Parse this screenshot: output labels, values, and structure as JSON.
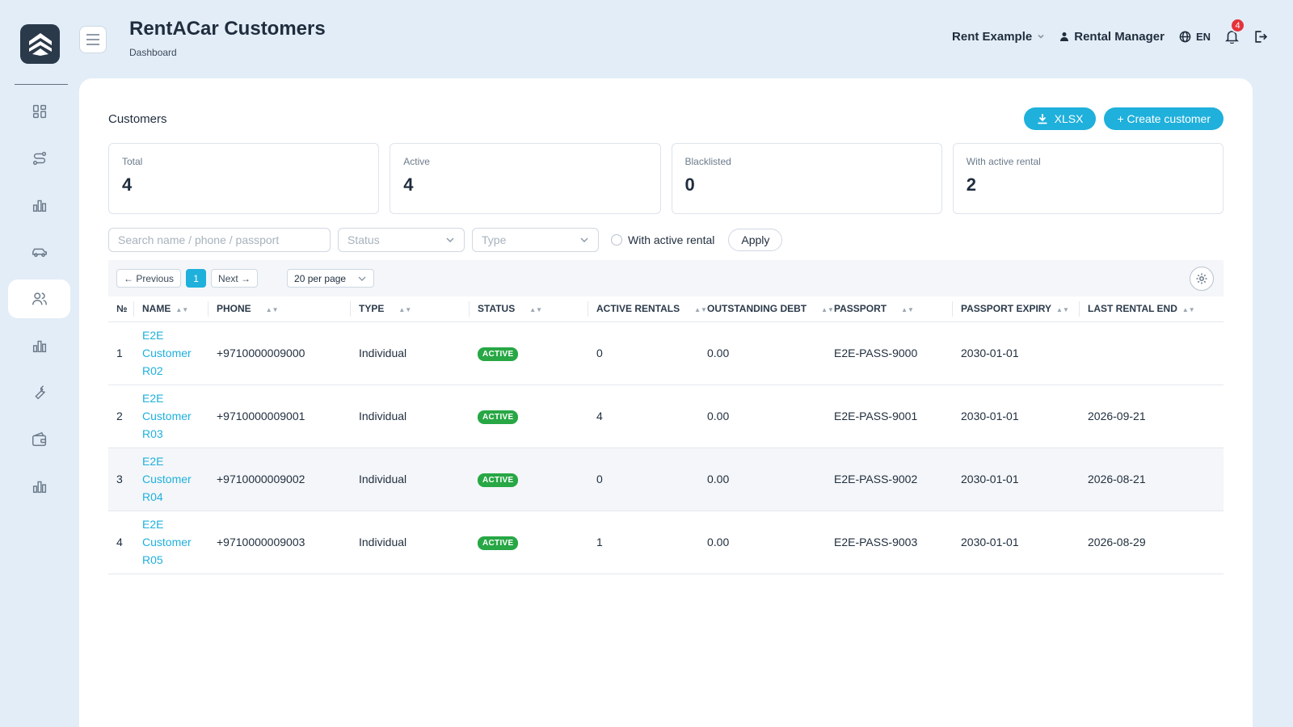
{
  "header": {
    "title": "RentACar Customers",
    "breadcrumb": "Dashboard",
    "company": "Rent Example",
    "user": "Rental Manager",
    "language": "EN",
    "notification_count": "4"
  },
  "sidebar": {
    "items": [
      {
        "icon": "dashboard-icon"
      },
      {
        "icon": "route-icon"
      },
      {
        "icon": "chart-icon"
      },
      {
        "icon": "car-icon"
      },
      {
        "icon": "users-icon",
        "active": true
      },
      {
        "icon": "chart-icon"
      },
      {
        "icon": "wrench-icon"
      },
      {
        "icon": "wallet-icon"
      },
      {
        "icon": "chart-icon"
      }
    ]
  },
  "main": {
    "section_title": "Customers",
    "xlsx_label": "XLSX",
    "create_label": "+ Create customer",
    "stats": [
      {
        "label": "Total",
        "value": "4"
      },
      {
        "label": "Active",
        "value": "4"
      },
      {
        "label": "Blacklisted",
        "value": "0"
      },
      {
        "label": "With active rental",
        "value": "2"
      }
    ],
    "filters": {
      "search_placeholder": "Search name / phone / passport",
      "status_placeholder": "Status",
      "type_placeholder": "Type",
      "active_rental_label": "With active rental",
      "apply_label": "Apply"
    },
    "pagination": {
      "prev": "← Previous",
      "current": "1",
      "next": "Next →",
      "per_page": "20 per page"
    },
    "columns": [
      "№",
      "NAME",
      "PHONE",
      "TYPE",
      "STATUS",
      "ACTIVE RENTALS",
      "OUTSTANDING DEBT",
      "PASSPORT",
      "PASSPORT EXPIRY",
      "LAST RENTAL END"
    ],
    "rows": [
      {
        "no": "1",
        "name": "E2E Customer R02",
        "phone": "+9710000009000",
        "type": "Individual",
        "status": "ACTIVE",
        "active_rentals": "0",
        "debt": "0.00",
        "passport": "E2E-PASS-9000",
        "expiry": "2030-01-01",
        "last_end": ""
      },
      {
        "no": "2",
        "name": "E2E Customer R03",
        "phone": "+9710000009001",
        "type": "Individual",
        "status": "ACTIVE",
        "active_rentals": "4",
        "debt": "0.00",
        "passport": "E2E-PASS-9001",
        "expiry": "2030-01-01",
        "last_end": "2026-09-21"
      },
      {
        "no": "3",
        "name": "E2E Customer R04",
        "phone": "+9710000009002",
        "type": "Individual",
        "status": "ACTIVE",
        "active_rentals": "0",
        "debt": "0.00",
        "passport": "E2E-PASS-9002",
        "expiry": "2030-01-01",
        "last_end": "2026-08-21"
      },
      {
        "no": "4",
        "name": "E2E Customer R05",
        "phone": "+9710000009003",
        "type": "Individual",
        "status": "ACTIVE",
        "active_rentals": "1",
        "debt": "0.00",
        "passport": "E2E-PASS-9003",
        "expiry": "2030-01-01",
        "last_end": "2026-08-29"
      }
    ]
  },
  "colors": {
    "accent": "#1fb0dc",
    "background": "#e3edf7",
    "status_active": "#28a745",
    "notification": "#e5323a"
  }
}
